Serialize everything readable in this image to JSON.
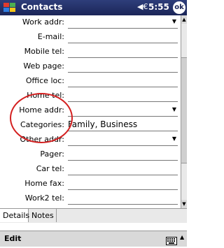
{
  "titlebar": {
    "title": "Contacts",
    "volume_icon": "speaker-icon",
    "time": "5:55",
    "ok_label": "ok"
  },
  "form": {
    "rows": [
      {
        "label": "Work addr:",
        "value": "",
        "dropdown": true
      },
      {
        "label": "E-mail:",
        "value": "",
        "dropdown": false
      },
      {
        "label": "Mobile tel:",
        "value": "",
        "dropdown": false
      },
      {
        "label": "Web page:",
        "value": "",
        "dropdown": false
      },
      {
        "label": "Office loc:",
        "value": "",
        "dropdown": false
      },
      {
        "label": "Home tel:",
        "value": "",
        "dropdown": false
      },
      {
        "label": "Home addr:",
        "value": "",
        "dropdown": true
      },
      {
        "label": "Categories:",
        "value": "Family, Business",
        "dropdown": false
      },
      {
        "label": "Other addr:",
        "value": "",
        "dropdown": true
      },
      {
        "label": "Pager:",
        "value": "",
        "dropdown": false
      },
      {
        "label": "Car tel:",
        "value": "",
        "dropdown": false
      },
      {
        "label": "Home fax:",
        "value": "",
        "dropdown": false
      },
      {
        "label": "Work2 tel:",
        "value": "",
        "dropdown": false
      }
    ]
  },
  "tabs": [
    {
      "label": "Details",
      "active": true
    },
    {
      "label": "Notes",
      "active": false
    }
  ],
  "cmdbar": {
    "edit_label": "Edit",
    "keyboard_icon": "keyboard-icon"
  },
  "colors": {
    "titlebar": "#1b2558",
    "annotation": "#d42020"
  }
}
